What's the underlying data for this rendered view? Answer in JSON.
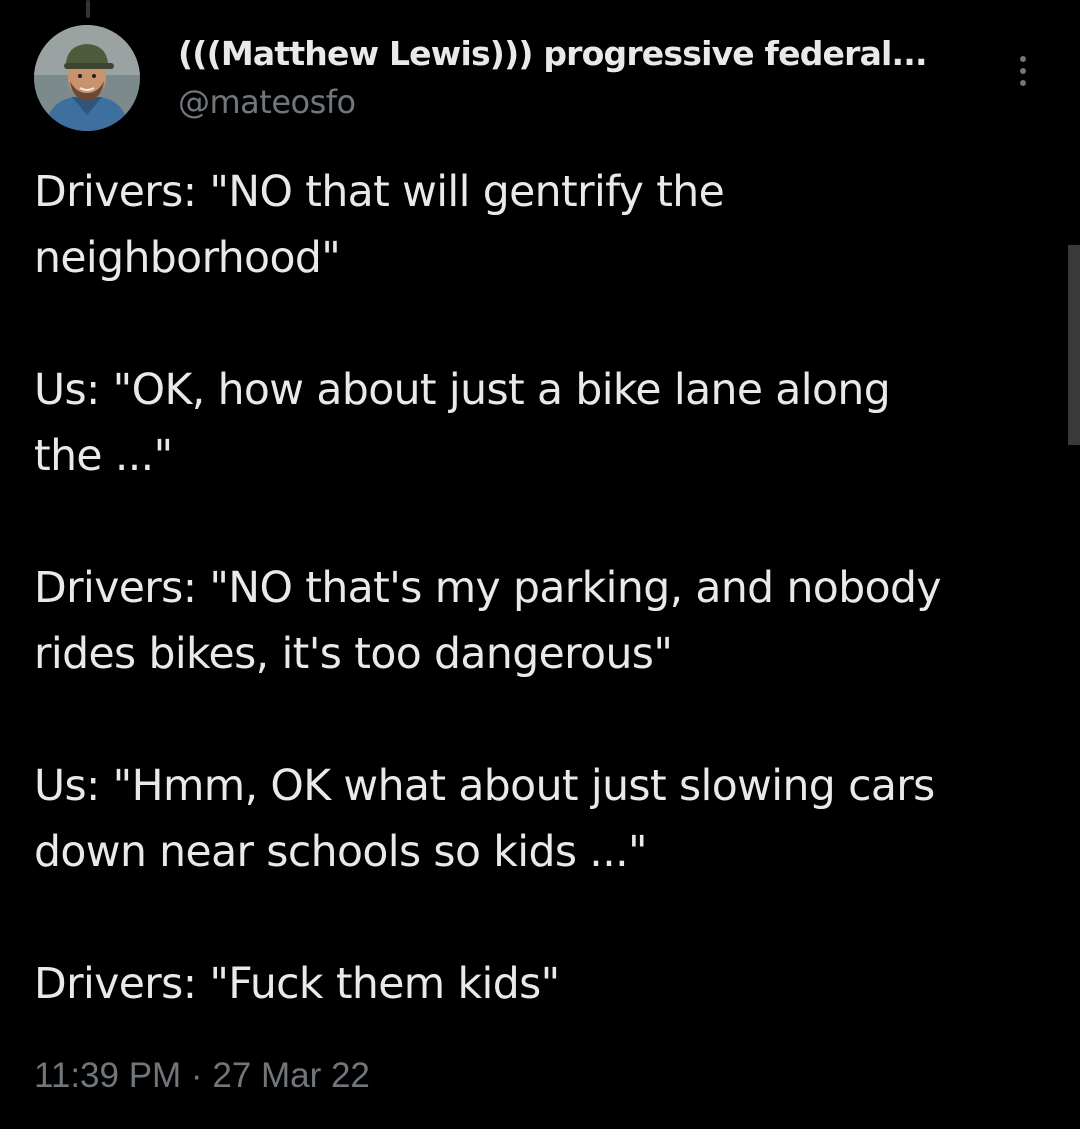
{
  "author": {
    "display_name": "(((Matthew Lewis))) progressive federal...",
    "handle": "@mateosfo"
  },
  "tweet": {
    "lines": [
      "Drivers: \"NO that will gentrify the",
      "neighborhood\"",
      "",
      "Us: \"OK, how about just a bike lane along",
      "the ...\"",
      "",
      "Drivers: \"NO that's my parking, and nobody",
      "rides bikes, it's too dangerous\"",
      "",
      "Us: \"Hmm, OK what about just slowing cars",
      "down near schools so kids ...\"",
      "",
      "Drivers: \"Fuck them kids\""
    ],
    "timestamp": "11:39 PM · 27 Mar 22"
  },
  "icons": {
    "more": "more-vertical-icon"
  },
  "colors": {
    "background": "#000000",
    "primary_text": "#e7e9ea",
    "secondary_text": "#71767b"
  }
}
